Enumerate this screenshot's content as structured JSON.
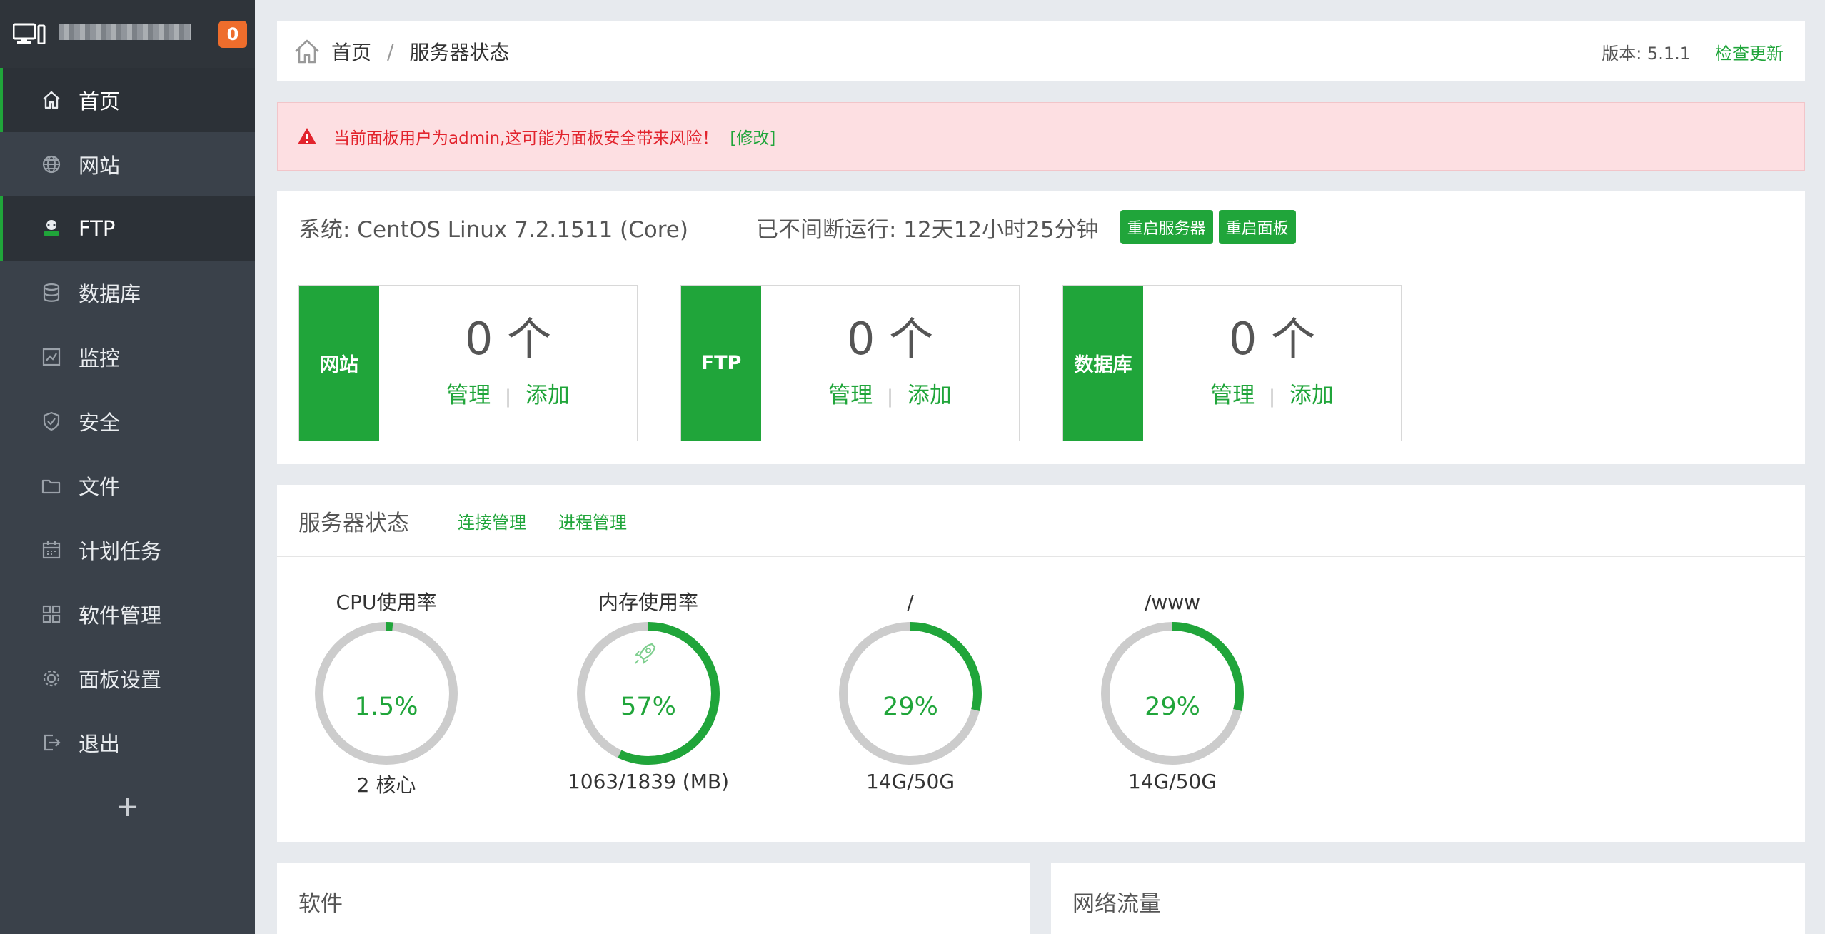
{
  "sidebar": {
    "badge": "0",
    "items": [
      {
        "label": "首页",
        "icon": "home-icon"
      },
      {
        "label": "网站",
        "icon": "globe-icon"
      },
      {
        "label": "FTP",
        "icon": "ftp-icon"
      },
      {
        "label": "数据库",
        "icon": "database-icon"
      },
      {
        "label": "监控",
        "icon": "monitor-icon"
      },
      {
        "label": "安全",
        "icon": "shield-icon"
      },
      {
        "label": "文件",
        "icon": "folder-icon"
      },
      {
        "label": "计划任务",
        "icon": "calendar-icon"
      },
      {
        "label": "软件管理",
        "icon": "grid-icon"
      },
      {
        "label": "面板设置",
        "icon": "gear-icon"
      },
      {
        "label": "退出",
        "icon": "logout-icon"
      }
    ],
    "add_label": "+"
  },
  "breadcrumb": {
    "home": "首页",
    "separator": "/",
    "current": "服务器状态"
  },
  "version": {
    "label": "版本: 5.1.1",
    "update": "检查更新"
  },
  "alert": {
    "message": "当前面板用户为admin,这可能为面板安全带来风险！",
    "fix": "[修改]"
  },
  "system": {
    "os": "系统: CentOS Linux 7.2.1511 (Core)",
    "uptime": "已不间断运行: 12天12小时25分钟",
    "restart_server": "重启服务器",
    "restart_panel": "重启面板"
  },
  "tiles": [
    {
      "label": "网站",
      "count": "0 个",
      "manage": "管理",
      "divider": "|",
      "add": "添加"
    },
    {
      "label": "FTP",
      "count": "0 个",
      "manage": "管理",
      "divider": "|",
      "add": "添加"
    },
    {
      "label": "数据库",
      "count": "0 个",
      "manage": "管理",
      "divider": "|",
      "add": "添加"
    }
  ],
  "server_status": {
    "title": "服务器状态",
    "connections": "连接管理",
    "processes": "进程管理",
    "gauges": [
      {
        "title": "CPU使用率",
        "value": "1.5%",
        "percent": 1.5,
        "bottom": "2 核心"
      },
      {
        "title": "内存使用率",
        "value": "57%",
        "percent": 57,
        "bottom": "1063/1839 (MB)",
        "icon": "rocket-icon"
      },
      {
        "title": "/",
        "value": "29%",
        "percent": 29,
        "bottom": "14G/50G"
      },
      {
        "title": "/www",
        "value": "29%",
        "percent": 29,
        "bottom": "14G/50G"
      }
    ]
  },
  "panels": {
    "software": "软件",
    "traffic": "网络流量"
  },
  "colors": {
    "accent": "#20a53a",
    "sidebar": "#3a414a",
    "badge": "#ee6d2c",
    "alert_bg": "#fddfe2",
    "alert_text": "#e2242d"
  }
}
